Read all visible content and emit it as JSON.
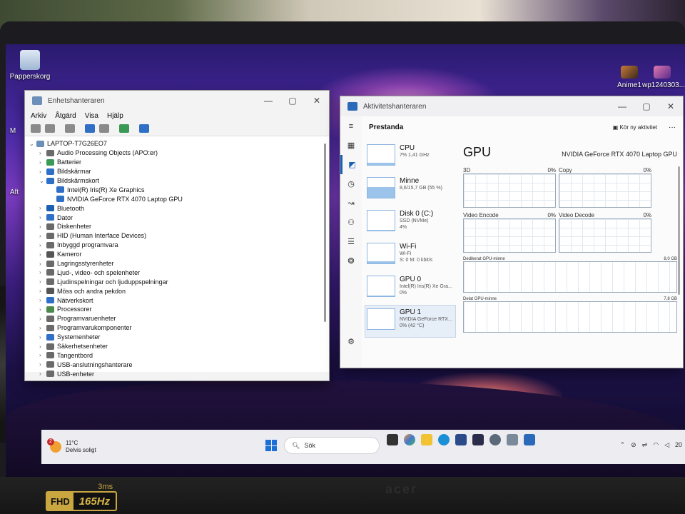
{
  "desktop": {
    "recycle_bin_label": "Papperskorg",
    "left_partial_labels": [
      "M",
      "Aft"
    ],
    "right_icons": [
      {
        "label": "Anime1"
      },
      {
        "label": "wp1240303..."
      }
    ]
  },
  "device_manager": {
    "title": "Enhetshanteraren",
    "menu": [
      "Arkiv",
      "Åtgärd",
      "Visa",
      "Hjälp"
    ],
    "caption": {
      "minimize": "—",
      "maximize": "▢",
      "close": "✕"
    },
    "root": "LAPTOP-T7G26EO7",
    "nodes": [
      {
        "label": "Audio Processing Objects (APO:er)",
        "expander": "›",
        "color": "#6a6a6a"
      },
      {
        "label": "Batterier",
        "expander": "›",
        "color": "#3a9a55"
      },
      {
        "label": "Bildskärmar",
        "expander": "›",
        "color": "#2f6fc6"
      },
      {
        "label": "Bildskärmskort",
        "expander": "⌄",
        "color": "#2f6fc6"
      },
      {
        "label": "Intel(R) Iris(R) Xe Graphics",
        "expander": "",
        "color": "#2f6fc6",
        "child": true
      },
      {
        "label": "NVIDIA GeForce RTX 4070 Laptop GPU",
        "expander": "",
        "color": "#2f6fc6",
        "child": true
      },
      {
        "label": "Bluetooth",
        "expander": "›",
        "color": "#1a5fb4"
      },
      {
        "label": "Dator",
        "expander": "›",
        "color": "#2f6fc6"
      },
      {
        "label": "Diskenheter",
        "expander": "›",
        "color": "#6a6a6a"
      },
      {
        "label": "HID (Human Interface Devices)",
        "expander": "›",
        "color": "#6a6a6a"
      },
      {
        "label": "Inbyggd programvara",
        "expander": "›",
        "color": "#6a6a6a"
      },
      {
        "label": "Kameror",
        "expander": "›",
        "color": "#555555"
      },
      {
        "label": "Lagringsstyrenheter",
        "expander": "›",
        "color": "#6a6a6a"
      },
      {
        "label": "Ljud-, video- och spelenheter",
        "expander": "›",
        "color": "#6a6a6a"
      },
      {
        "label": "Ljudinspelningar och ljuduppspelningar",
        "expander": "›",
        "color": "#6a6a6a"
      },
      {
        "label": "Möss och andra pekdon",
        "expander": "›",
        "color": "#555555"
      },
      {
        "label": "Nätverkskort",
        "expander": "›",
        "color": "#2f6fc6"
      },
      {
        "label": "Processorer",
        "expander": "›",
        "color": "#4a8a4a"
      },
      {
        "label": "Programvaruenheter",
        "expander": "›",
        "color": "#6a6a6a"
      },
      {
        "label": "Programvarukomponenter",
        "expander": "›",
        "color": "#6a6a6a"
      },
      {
        "label": "Systemenheter",
        "expander": "›",
        "color": "#2f6fc6"
      },
      {
        "label": "Säkerhetsenheter",
        "expander": "›",
        "color": "#6a6a6a"
      },
      {
        "label": "Tangentbord",
        "expander": "›",
        "color": "#6a6a6a"
      },
      {
        "label": "USB-anslutningshanterare",
        "expander": "›",
        "color": "#6a6a6a"
      },
      {
        "label": "USB-enheter",
        "expander": "›",
        "color": "#6a6a6a"
      }
    ]
  },
  "task_manager": {
    "title": "Aktivitetshanteraren",
    "caption": {
      "minimize": "—",
      "maximize": "▢",
      "close": "✕"
    },
    "page_title": "Prestanda",
    "run_task": "Kör ny aktivitet",
    "more": "···",
    "items": [
      {
        "name": "CPU",
        "l1": "7% 1,41 GHz",
        "l2": "",
        "l3": "",
        "fill": 0.12
      },
      {
        "name": "Minne",
        "l1": "8,6/15,7 GB (55 %)",
        "l2": "",
        "l3": "",
        "fill": 0.55
      },
      {
        "name": "Disk 0 (C:)",
        "l1": "SSD (NVMe)",
        "l2": "4%",
        "l3": "",
        "fill": 0.04
      },
      {
        "name": "Wi-Fi",
        "l1": "Wi-Fi",
        "l2": "S: 0 M: 0 kbit/s",
        "l3": "",
        "fill": 0.1
      },
      {
        "name": "GPU 0",
        "l1": "Intel(R) Iris(R) Xe Gra...",
        "l2": "0%",
        "l3": "",
        "fill": 0.05
      },
      {
        "name": "GPU 1",
        "l1": "NVIDIA GeForce RTX...",
        "l2": "0% (42 °C)",
        "l3": "",
        "fill": 0.0
      }
    ],
    "gpu": {
      "title": "GPU",
      "model": "NVIDIA GeForce RTX 4070 Laptop GPU",
      "graphs": [
        {
          "label": "3D",
          "value": "0%"
        },
        {
          "label": "Copy",
          "value": "0%"
        },
        {
          "label": "Video Encode",
          "value": "0%"
        },
        {
          "label": "Video Decode",
          "value": "0%"
        }
      ],
      "dedicated_label": "Dedikerat GPU-minne",
      "dedicated_value": "8,0 GB",
      "shared_label": "Delat GPU-minne",
      "shared_value": "7,8 GB"
    }
  },
  "taskbar": {
    "temperature": "11°C",
    "weather_text": "Delvis soligt",
    "weather_badge": "2",
    "search_placeholder": "Sök",
    "tray_language": "20"
  },
  "bezel": {
    "fhd": "FHD",
    "refresh": "165Hz",
    "response": "3ms",
    "brand": "acer"
  }
}
